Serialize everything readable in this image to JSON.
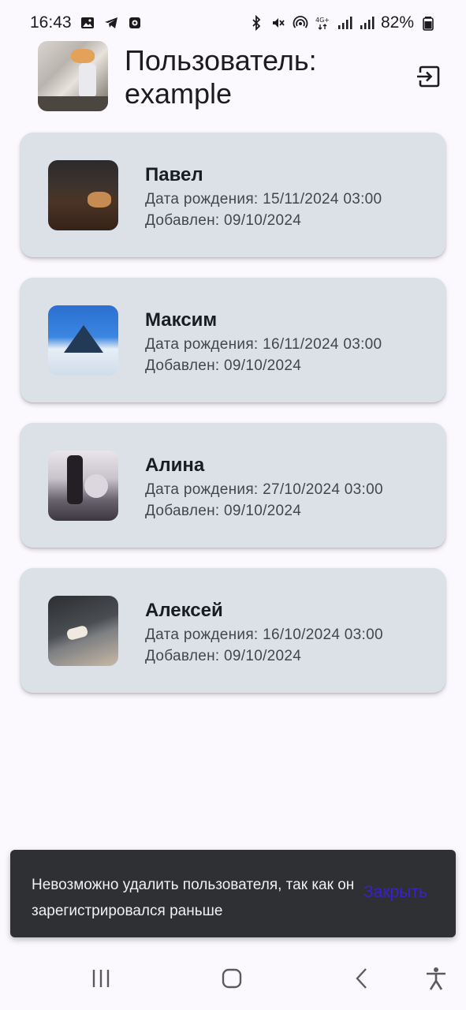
{
  "status_bar": {
    "time": "16:43",
    "battery": "82%",
    "left_icons": [
      "image-icon",
      "telegram-icon",
      "app-icon"
    ],
    "right_icons": [
      "bluetooth-icon",
      "mute-icon",
      "hotspot-icon",
      "4g-icon",
      "signal-icon",
      "signal-icon",
      "battery-icon"
    ]
  },
  "header": {
    "title": "Пользователь: example",
    "logout_icon": "logout-icon"
  },
  "users": [
    {
      "name": "Павел",
      "dob": "Дата рождения: 15/11/2024 03:00",
      "added": "Добавлен: 09/10/2024"
    },
    {
      "name": "Максим",
      "dob": "Дата рождения: 16/11/2024 03:00",
      "added": "Добавлен: 09/10/2024"
    },
    {
      "name": "Алина",
      "dob": "Дата рождения: 27/10/2024 03:00",
      "added": "Добавлен: 09/10/2024"
    },
    {
      "name": "Алексей",
      "dob": "Дата рождения: 16/10/2024 03:00",
      "added": "Добавлен: 09/10/2024"
    }
  ],
  "snackbar": {
    "message": "Невозможно удалить пользователя, так как он зарегистрировался раньше",
    "action": "Закрыть",
    "action_color": "#3a1fd0"
  },
  "navbar": {
    "icons": [
      "recents-icon",
      "home-icon",
      "back-icon",
      "accessibility-icon"
    ]
  },
  "colors": {
    "background": "#fbf9fd",
    "card": "#dce1e7",
    "snackbar": "#2f3033"
  }
}
